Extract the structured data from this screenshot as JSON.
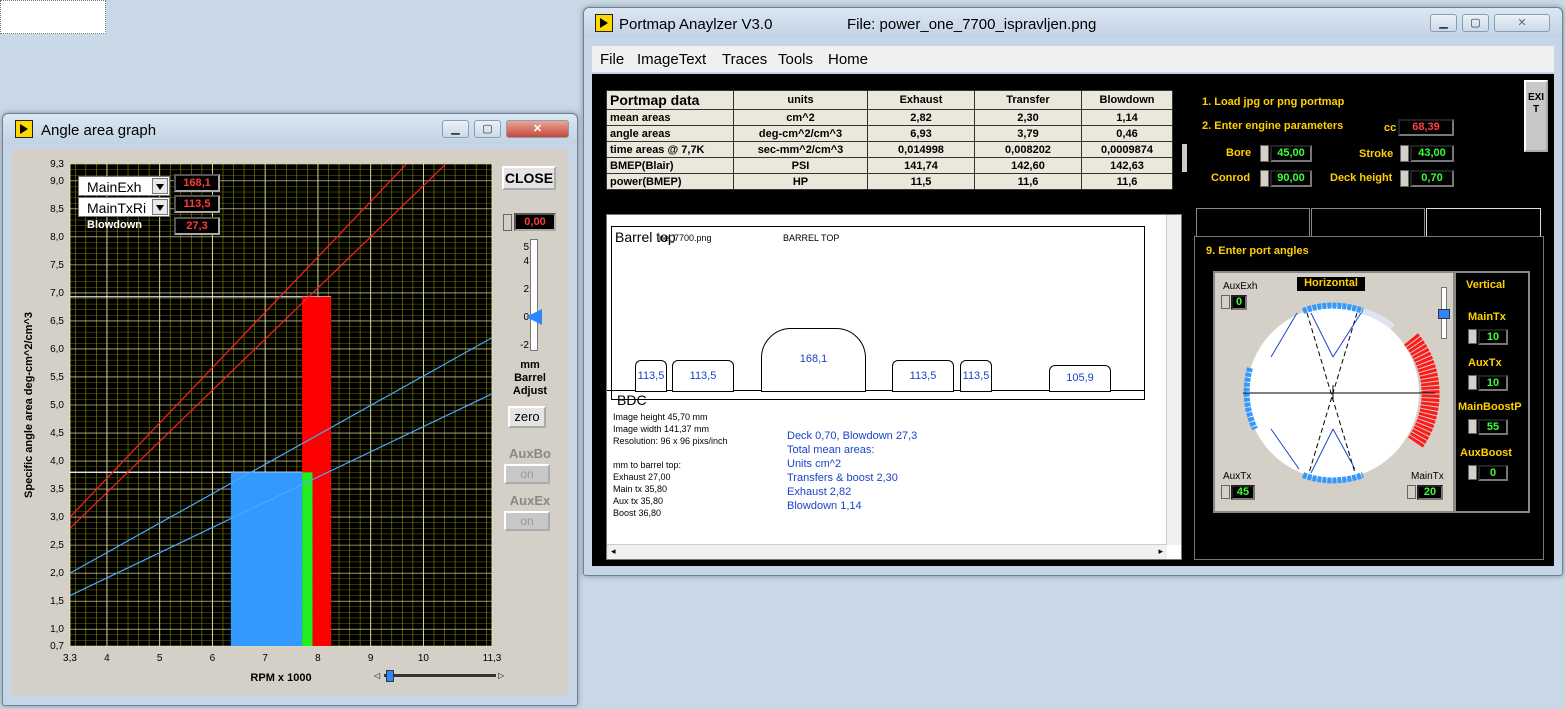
{
  "angle_window": {
    "title": "Angle area graph",
    "legend": [
      {
        "name": "MainExh",
        "value": "168,1"
      },
      {
        "name": "MainTxRi",
        "value": "113,5"
      },
      {
        "name": "Blowdown",
        "value": "27,3"
      }
    ],
    "close_label": "CLOSE",
    "barrel_adjust": {
      "value": "0,00",
      "ticks": [
        "5",
        "4",
        "2",
        "0",
        "-2"
      ],
      "label_mm": "mm",
      "label_barrel": "Barrel",
      "label_adjust": "Adjust"
    },
    "zero_label": "zero",
    "auxbo": {
      "label": "AuxBo",
      "btn": "on"
    },
    "auxex": {
      "label": "AuxEx",
      "btn": "on"
    }
  },
  "chart_data": {
    "type": "line",
    "xlabel": "RPM x 1000",
    "ylabel": "Specific angle area  deg-cm^2/cm^3",
    "xlim": [
      3.3,
      11.3
    ],
    "ylim": [
      0.7,
      9.3
    ],
    "x_ticks": [
      "3,3",
      "4",
      "5",
      "6",
      "7",
      "8",
      "9",
      "10",
      "11,3"
    ],
    "y_ticks": [
      "0,7",
      "1,0",
      "1,5",
      "2,0",
      "2,5",
      "3,0",
      "3,5",
      "4,0",
      "4,5",
      "5,0",
      "5,5",
      "6,0",
      "6,5",
      "7,0",
      "7,5",
      "8,0",
      "8,5",
      "9,0",
      "9,3"
    ],
    "grid": true,
    "series": [
      {
        "color": "#ff2020",
        "x": [
          3.3,
          11.3
        ],
        "y": [
          3.0,
          10.9
        ]
      },
      {
        "color": "#ff2020",
        "x": [
          3.3,
          11.3
        ],
        "y": [
          2.8,
          10.1
        ]
      },
      {
        "color": "#4aa8ff",
        "x": [
          3.3,
          11.3
        ],
        "y": [
          2.0,
          6.2
        ]
      },
      {
        "color": "#4aa8ff",
        "x": [
          3.3,
          11.3
        ],
        "y": [
          1.6,
          5.2
        ]
      }
    ],
    "bars": [
      {
        "color": "#3399ff",
        "x0": 6.35,
        "x1": 7.7,
        "y0": 0.7,
        "y1": 3.8
      },
      {
        "color": "#22ee22",
        "x0": 7.7,
        "x1": 7.9,
        "y0": 0.7,
        "y1": 3.8
      },
      {
        "color": "#ff0000",
        "x0": 7.9,
        "x1": 8.25,
        "y0": 0.7,
        "y1": 3.8
      },
      {
        "color": "#ff0000",
        "x0": 7.7,
        "x1": 8.25,
        "y0": 3.8,
        "y1": 6.93
      }
    ],
    "hlines": [
      {
        "y": 6.93,
        "x_end": 8.25
      },
      {
        "y": 3.8,
        "x_end": 7.7
      }
    ]
  },
  "portmap_window": {
    "title": "Portmap Anaylzer V3.0",
    "file": "File: power_one_7700_ispravljen.png",
    "menu": [
      "File",
      "ImageText",
      "Traces",
      "Tools",
      "Home"
    ],
    "table": {
      "headers": [
        "Portmap data",
        "units",
        "Exhaust",
        "Transfer",
        "Blowdown"
      ],
      "rows": [
        [
          "mean areas",
          "cm^2",
          "2,82",
          "2,30",
          "1,14"
        ],
        [
          "angle areas",
          "deg-cm^2/cm^3",
          "6,93",
          "3,79",
          "0,46"
        ],
        [
          "time areas @ 7,7K",
          "sec-mm^2/cm^3",
          "0,014998",
          "0,008202",
          "0,0009874"
        ],
        [
          "BMEP(Blair)",
          "PSI",
          "141,74",
          "142,60",
          "142,63"
        ],
        [
          "power(BMEP)",
          "HP",
          "11,5",
          "11,6",
          "11,6"
        ]
      ]
    },
    "steps": {
      "load": "1. Load jpg or png portmap",
      "engine": "2. Enter engine parameters",
      "ports": "9. Enter port angles"
    },
    "engine": {
      "cc_label": "cc",
      "cc": "68,39",
      "bore_label": "Bore",
      "bore": "45,00",
      "stroke_label": "Stroke",
      "stroke": "43,00",
      "conrod_label": "Conrod",
      "conrod": "90,00",
      "deck_label": "Deck height",
      "deck": "0,70"
    },
    "exit_label": "EXIT",
    "image": {
      "top_overlay1": "Barrel top",
      "top_overlay2": "ne_7700.png",
      "barrel_top": "BARREL TOP",
      "bdc": "BDC",
      "ports": [
        "113,5",
        "113,5",
        "168,1",
        "113,5",
        "113,5",
        "105,9"
      ],
      "info": [
        "Image height  45,70 mm",
        "Image width  141,37 mm",
        "Resolution: 96 x 96 pixs/inch",
        "",
        "mm to barrel top:",
        "Exhaust  27,00",
        "Main tx   35,80",
        "Aux tx    35,80",
        "Boost     36,80"
      ],
      "summary": [
        "Deck 0,70,  Blowdown 27,3",
        "Total mean areas:",
        "Units  cm^2",
        "Transfers & boost  2,30",
        "Exhaust  2,82",
        "Blowdown  1,14"
      ]
    },
    "horizontal": {
      "title": "Horizontal",
      "auxexh_label": "AuxExh",
      "auxexh": "0",
      "auxtx_label": "AuxTx",
      "auxtx": "45",
      "maintx_label": "MainTx",
      "maintx": "20"
    },
    "vertical": {
      "title": "Vertical",
      "maintx_label": "MainTx",
      "maintx": "10",
      "auxtx_label": "AuxTx",
      "auxtx": "10",
      "mainboost_label": "MainBoostP",
      "mainboost": "55",
      "auxboost_label": "AuxBoost",
      "auxboost": "0"
    }
  }
}
